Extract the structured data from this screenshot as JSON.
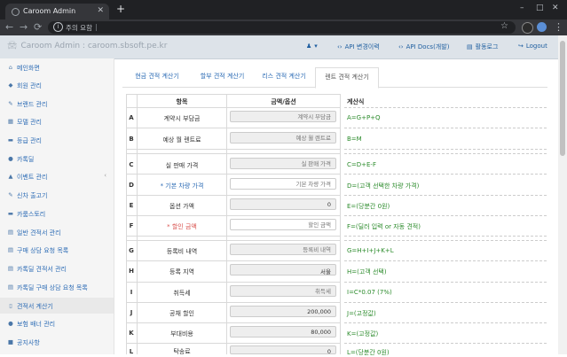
{
  "browser": {
    "tab_title": "Caroom Admin",
    "security_label": "주의 요함",
    "nav": {
      "back": "←",
      "forward": "→",
      "reload": "⟳"
    },
    "new_tab": "+",
    "window": {
      "minimize": "–",
      "maximize": "□",
      "close": "✕"
    }
  },
  "navbar": {
    "brand": "Caroom Admin : caroom.sbsoft.pe.kr",
    "links": [
      {
        "label": "",
        "icon": "person-icon"
      },
      {
        "label": "API 변경이력",
        "icon": "code-icon"
      },
      {
        "label": "API Docs(개발)",
        "icon": "code-icon"
      },
      {
        "label": "활동로그",
        "icon": "list-icon"
      },
      {
        "label": "Logout",
        "icon": "logout-icon"
      }
    ]
  },
  "sidebar": {
    "items": [
      {
        "label": "메인화면",
        "icon": "⌂"
      },
      {
        "label": "회원 관리",
        "icon": "◆"
      },
      {
        "label": "브랜드 관리",
        "icon": "✎"
      },
      {
        "label": "모델 관리",
        "icon": "▦"
      },
      {
        "label": "등급 관리",
        "icon": "▬"
      },
      {
        "label": "카톡딜",
        "icon": "●"
      },
      {
        "label": "이벤트 관리",
        "icon": "▲"
      },
      {
        "label": "신차 출고기",
        "icon": "✎"
      },
      {
        "label": "카룸스토리",
        "icon": "▬"
      },
      {
        "label": "일반 견적서 관리",
        "icon": "▤"
      },
      {
        "label": "구매 상담 요청 목록",
        "icon": "▤"
      },
      {
        "label": "카톡딜 견적서 관리",
        "icon": "▤"
      },
      {
        "label": "카톡딜 구매 상담 요청 목록",
        "icon": "▤"
      },
      {
        "label": "견적서 계산기",
        "icon": "▯"
      },
      {
        "label": "보험 배너 관리",
        "icon": "●"
      },
      {
        "label": "공지사항",
        "icon": "■"
      }
    ]
  },
  "tabs": [
    "현금 견적 계산기",
    "할부 견적 계산기",
    "리스 견적 계산기",
    "렌트 견적 계산기"
  ],
  "table": {
    "headers": {
      "item": "항목",
      "amount": "금액/옵션",
      "formula": "계산식"
    },
    "rows": [
      {
        "letter": "A",
        "label": "계약시 부담금",
        "field": "계약시 부담금",
        "formula": "A=G+P+Q"
      },
      {
        "letter": "B",
        "label": "예상 월 렌트료",
        "field": "예상 월 렌트료",
        "formula": "B=M"
      },
      {
        "letter": "C",
        "label": "실 판매 가격",
        "field": "실 판매 가격",
        "formula": "C=D+E-F"
      },
      {
        "letter": "D",
        "label": "* 기본 차량 가격",
        "field": "기본 차량 가격",
        "formula": "D=(고객 선택한 차량 가격)"
      },
      {
        "letter": "E",
        "label": "옵션 가액",
        "field": "0",
        "formula": "E=(당분간 0원)"
      },
      {
        "letter": "F",
        "label": "* 할인 금액",
        "field": "할인 금액",
        "formula": "F=(딜러 입력 or 자동 견적)"
      },
      {
        "letter": "G",
        "label": "등록비 내역",
        "field": "등록비 내역",
        "formula": "G=H+I+J+K+L"
      },
      {
        "letter": "H",
        "label": "등록 지역",
        "field": "서울",
        "formula": "H=(고객 선택)"
      },
      {
        "letter": "I",
        "label": "취득세",
        "field": "취득세",
        "formula": "I=C*0.07 (7%)"
      },
      {
        "letter": "J",
        "label": "공채 할인",
        "field": "200,000",
        "formula": "J=(고정값)"
      },
      {
        "letter": "K",
        "label": "부대비용",
        "field": "80,000",
        "formula": "K=(고정값)"
      },
      {
        "letter": "L",
        "label": "탁송료",
        "field": "0",
        "formula": "L=(당분간 0원)"
      }
    ]
  }
}
